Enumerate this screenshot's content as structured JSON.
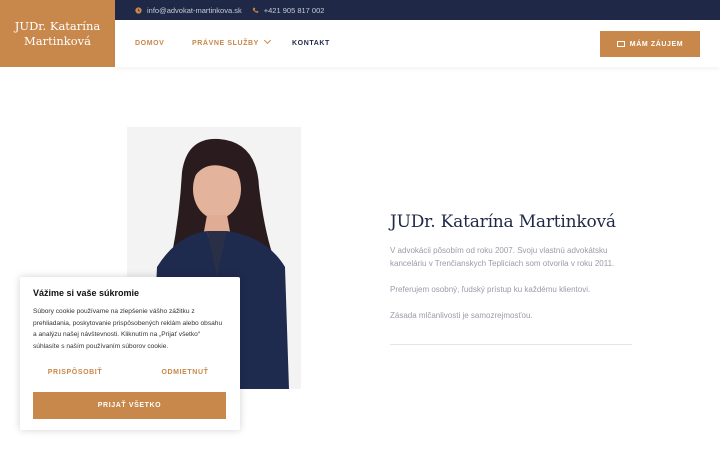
{
  "brand": {
    "logo_line1": "JUDr. Katarína",
    "logo_line2": "Martinková"
  },
  "topbar": {
    "email": "info@advokat-martinkova.sk",
    "phone": "+421 905 817 002",
    "email_icon": "clock-icon",
    "phone_icon": "phone-icon"
  },
  "nav": {
    "items": [
      {
        "label": "DOMOV"
      },
      {
        "label": "PRÁVNE SLUŽBY"
      },
      {
        "label": "KONTAKT"
      }
    ],
    "cta_label": "MÁM ZÁUJEM",
    "cta_icon": "envelope-icon"
  },
  "profile": {
    "name": "JUDr. Katarína Martinková",
    "p1": "V advokácii pôsobím od roku 2007. Svoju vlastnú advokátsku kanceláriu v Trenčianskych Tepliciach som otvorila v roku 2011.",
    "p2": "Preferujem osobný,  ľudský prístup ku každému klientovi.",
    "p3": "Zásada mlčanlivosti je samozrejmosťou."
  },
  "cookie": {
    "title": "Vážime si vaše súkromie",
    "text": "Súbory cookie používame na zlepšenie vášho zážitku z prehliadania, poskytovanie prispôsobených reklám alebo obsahu a analýzu našej návštevnosti. Kliknutím na „Prijať všetko“ súhlasíte s naším používaním súborov cookie.",
    "customize_label": "PRISPÔSOBIŤ",
    "reject_label": "ODMIETNUŤ",
    "accept_label": "PRIJAŤ VŠETKO"
  },
  "colors": {
    "accent": "#c8874b",
    "navy": "#1f2847",
    "text_muted": "#9a9ca8"
  }
}
